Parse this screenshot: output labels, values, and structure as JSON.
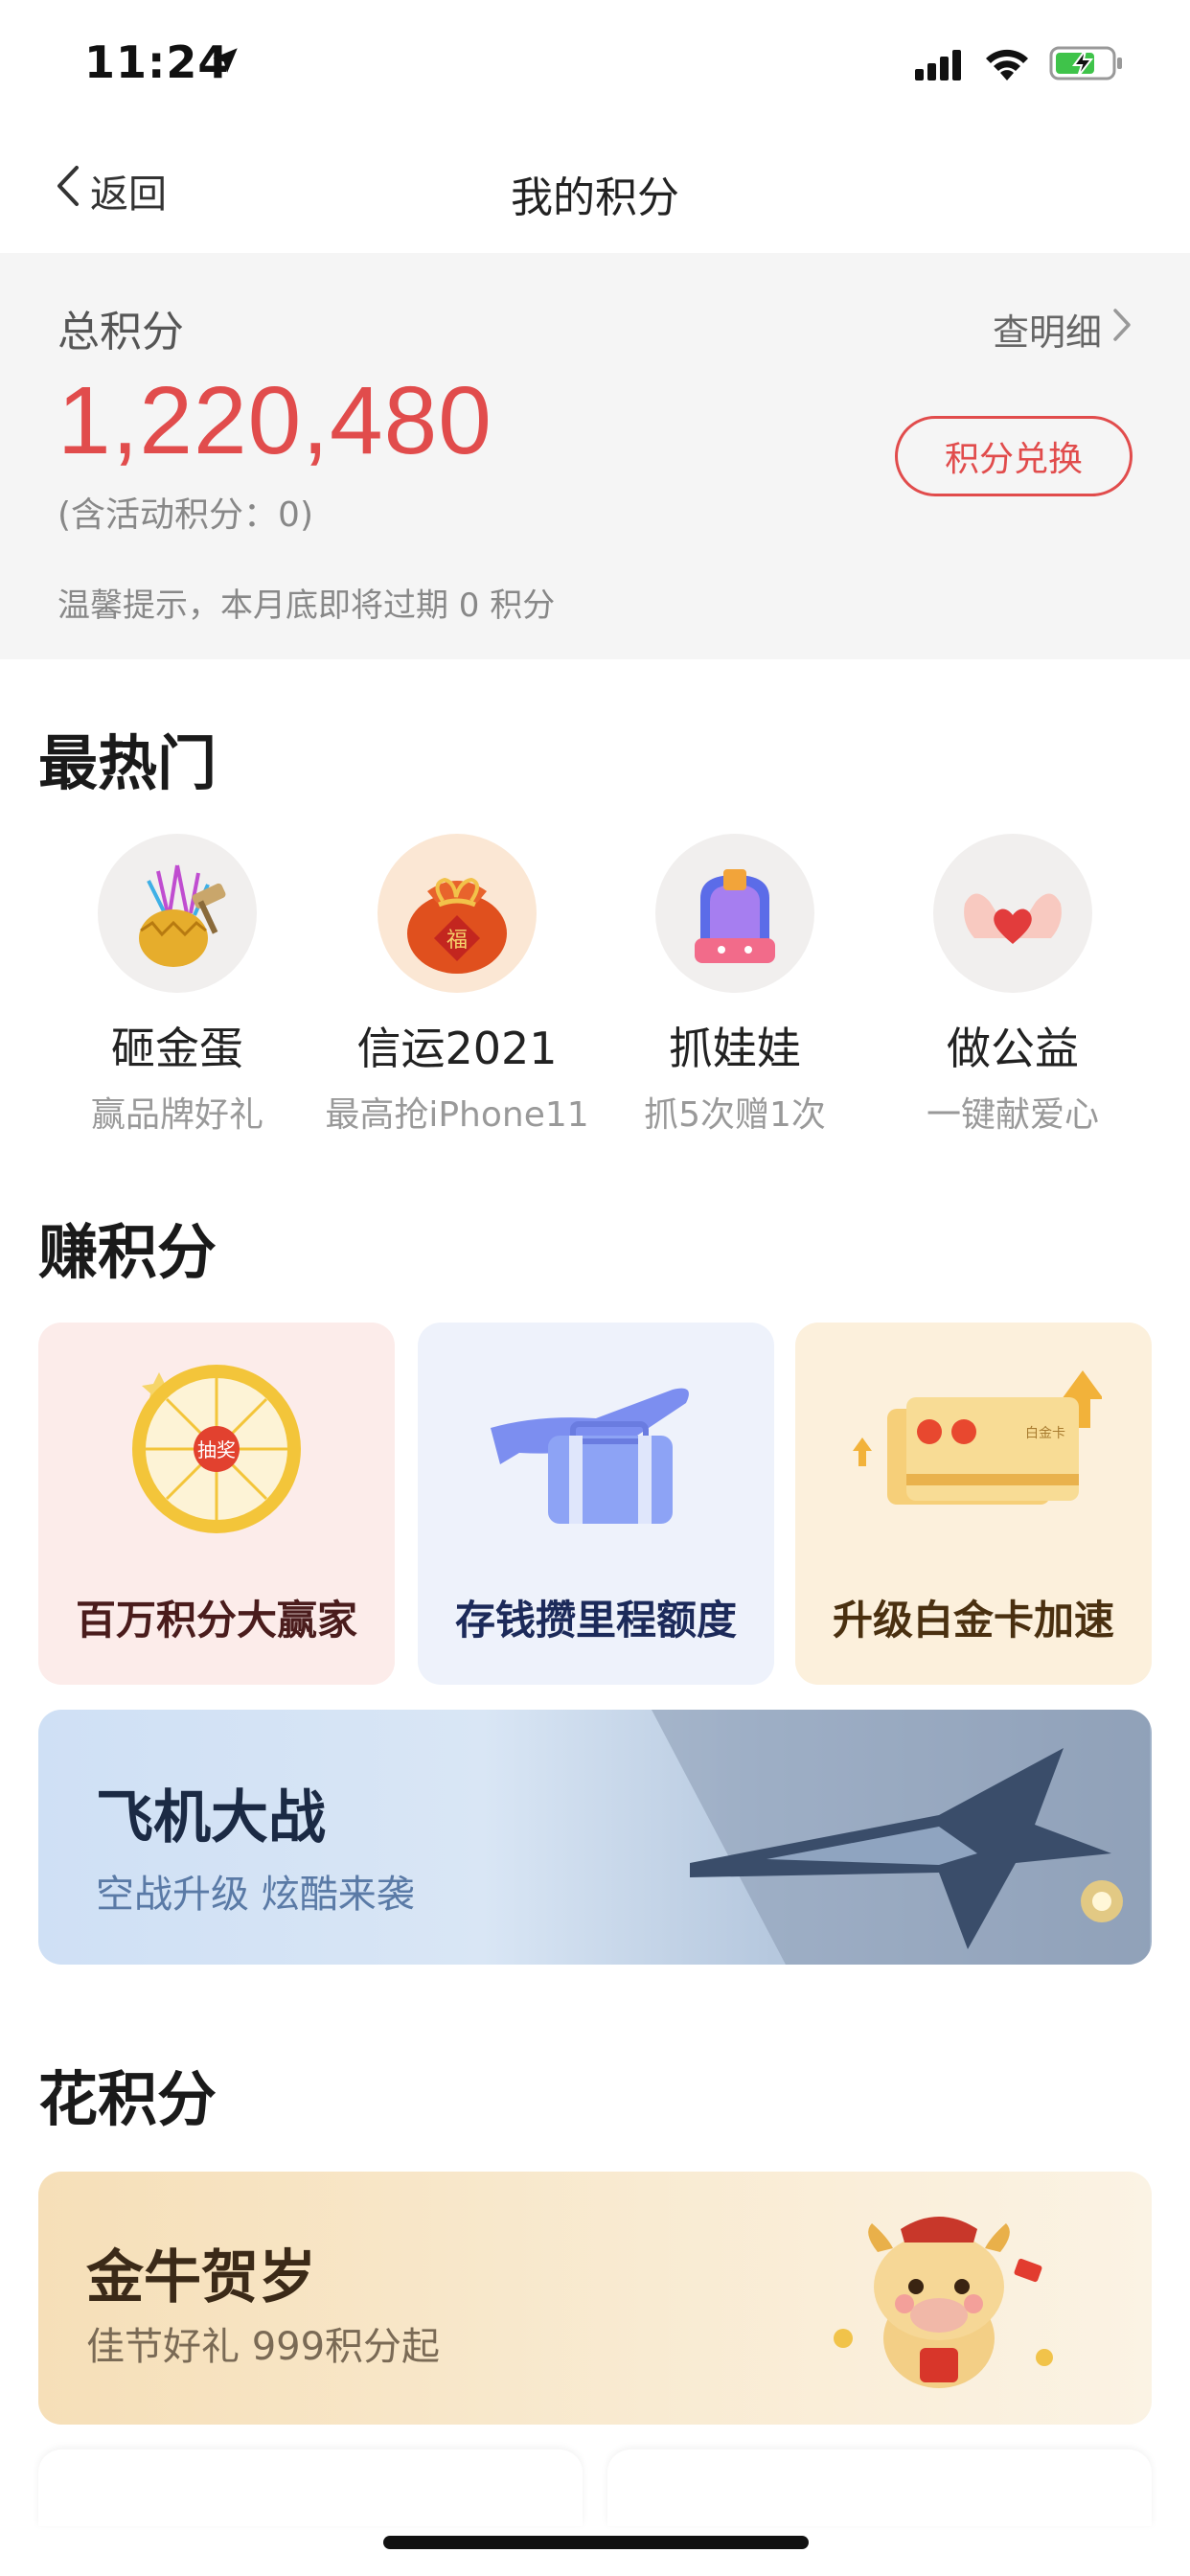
{
  "status_bar": {
    "time": "11:24"
  },
  "nav": {
    "back_label": "返回",
    "title": "我的积分"
  },
  "summary": {
    "label": "总积分",
    "detail_label": "查明细",
    "points": "1,220,480",
    "activity_note": "(含活动积分：0)",
    "exchange_label": "积分兑换",
    "tip": "温馨提示，本月底即将过期 0 积分"
  },
  "hot": {
    "title": "最热门",
    "items": [
      {
        "name": "砸金蛋",
        "sub": "赢品牌好礼",
        "icon": "golden-egg-icon"
      },
      {
        "name": "信运2021",
        "sub": "最高抢iPhone11",
        "icon": "lucky-bag-icon"
      },
      {
        "name": "抓娃娃",
        "sub": "抓5次赠1次",
        "icon": "claw-machine-icon"
      },
      {
        "name": "做公益",
        "sub": "一键献爱心",
        "icon": "heart-hands-icon"
      }
    ]
  },
  "earn": {
    "title": "赚积分",
    "cards": [
      {
        "label": "百万积分大赢家",
        "icon": "lottery-wheel-icon",
        "color": "#fcecea"
      },
      {
        "label": "存钱攒里程额度",
        "icon": "plane-suitcase-icon",
        "color": "#eef2fb"
      },
      {
        "label": "升级白金卡加速",
        "icon": "platinum-card-icon",
        "color": "#fcf0dc"
      }
    ],
    "wheel_center": "抽奖",
    "card_text": "白金卡",
    "banner": {
      "title": "飞机大战",
      "subtitle": "空战升级  炫酷来袭",
      "icon": "fighter-jet-icon"
    }
  },
  "spend": {
    "title": "花积分",
    "card": {
      "title": "金牛贺岁",
      "subtitle": "佳节好礼 999积分起",
      "icon": "golden-ox-icon"
    }
  },
  "colors": {
    "accent": "#e14c4c"
  }
}
